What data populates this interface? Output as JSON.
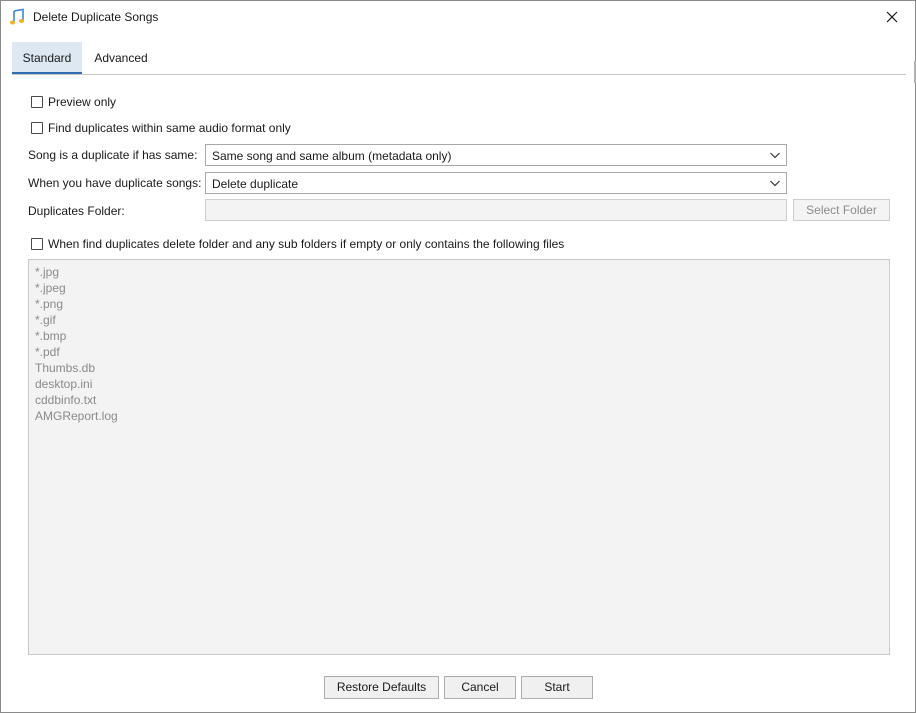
{
  "window": {
    "title": "Delete Duplicate Songs",
    "app_icon": "music-note-icon",
    "close_icon": "close-icon"
  },
  "tabs": [
    {
      "label": "Standard",
      "active": true
    },
    {
      "label": "Advanced",
      "active": false
    }
  ],
  "options": {
    "preview_only": {
      "label": "Preview only",
      "checked": false
    },
    "same_format": {
      "label": "Find duplicates within same audio format only",
      "checked": false
    },
    "delete_empty_folders": {
      "label": "When find duplicates delete folder and any sub folders if empty or only contains the following files",
      "checked": false
    }
  },
  "form": {
    "duplicate_if_label": "Song is a duplicate if has same:",
    "duplicate_if_value": "Same song and same album (metadata only)",
    "action_label": "When you have duplicate songs:",
    "action_value": "Delete duplicate",
    "folder_label": "Duplicates Folder:",
    "folder_value": "",
    "select_folder_label": "Select Folder"
  },
  "file_patterns": [
    "*.jpg",
    "*.jpeg",
    "*.png",
    "*.gif",
    "*.bmp",
    "*.pdf",
    "Thumbs.db",
    "desktop.ini",
    "cddbinfo.txt",
    "AMGReport.log"
  ],
  "buttons": {
    "restore_defaults": "Restore Defaults",
    "cancel": "Cancel",
    "start": "Start"
  },
  "colors": {
    "active_tab_bg": "#dde8f3",
    "active_tab_underline": "#2f6fb2",
    "disabled_text": "#8a8a8a"
  }
}
